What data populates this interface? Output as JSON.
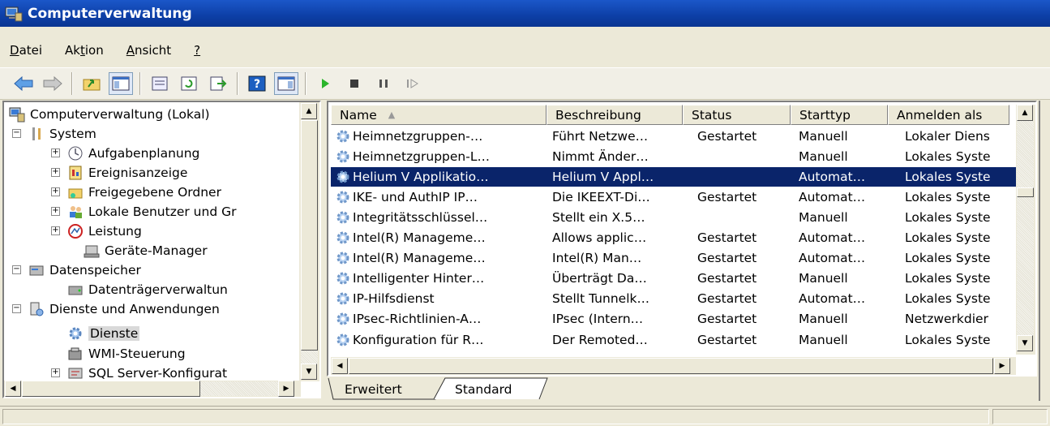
{
  "window": {
    "title": "Computerverwaltung"
  },
  "menu": {
    "datei": {
      "accel": "D",
      "rest": "atei"
    },
    "aktion": {
      "pre": "Ak",
      "accel": "t",
      "post": "ion"
    },
    "ansicht": {
      "accel": "A",
      "rest": "nsicht"
    },
    "help": {
      "accel": "?"
    }
  },
  "toolbar": {
    "icons": [
      "back-arrow-icon",
      "forward-arrow-icon",
      "folder-up-icon",
      "show-tree-icon",
      "properties-icon",
      "refresh-icon",
      "export-list-icon",
      "help-icon",
      "console-view-icon",
      "play-icon",
      "stop-icon",
      "pause-icon",
      "resume-icon"
    ]
  },
  "tree": {
    "root": "Computerverwaltung (Lokal)",
    "system": "System",
    "aufgaben": "Aufgabenplanung",
    "ereignis": "Ereignisanzeige",
    "freigaben": "Freigegebene Ordner",
    "lokale": "Lokale Benutzer und Gr",
    "leistung": "Leistung",
    "geraete": "Geräte-Manager",
    "datenspeicher": "Datenspeicher",
    "datentraeger": "Datenträgerverwaltun",
    "dienste_anw": "Dienste und Anwendungen",
    "dienste": "Dienste",
    "wmi": "WMI-Steuerung",
    "sql": "SQL Server-Konfigurat"
  },
  "list": {
    "columns": [
      "Name",
      "Beschreibung",
      "Status",
      "Starttyp",
      "Anmelden als"
    ],
    "sort_indicator": "▲",
    "rows": [
      {
        "name": "Heimnetzgruppen-…",
        "desc": "Führt Netzwe…",
        "status": "Gestartet",
        "start": "Manuell",
        "logon": "Lokaler Diens"
      },
      {
        "name": "Heimnetzgruppen-L…",
        "desc": "Nimmt Änder…",
        "status": "",
        "start": "Manuell",
        "logon": "Lokales Syste"
      },
      {
        "name": "Helium V Applikatio…",
        "desc": "Helium V Appl…",
        "status": "",
        "start": "Automat…",
        "logon": "Lokales Syste"
      },
      {
        "name": "IKE- und AuthIP IP…",
        "desc": "Die IKEEXT-Di…",
        "status": "Gestartet",
        "start": "Automat…",
        "logon": "Lokales Syste"
      },
      {
        "name": "Integritätsschlüssel…",
        "desc": "Stellt ein X.5…",
        "status": "",
        "start": "Manuell",
        "logon": "Lokales Syste"
      },
      {
        "name": "Intel(R) Manageme…",
        "desc": "Allows applic…",
        "status": "Gestartet",
        "start": "Automat…",
        "logon": "Lokales Syste"
      },
      {
        "name": "Intel(R) Manageme…",
        "desc": "Intel(R) Man…",
        "status": "Gestartet",
        "start": "Automat…",
        "logon": "Lokales Syste"
      },
      {
        "name": "Intelligenter Hinter…",
        "desc": "Überträgt Da…",
        "status": "Gestartet",
        "start": "Manuell",
        "logon": "Lokales Syste"
      },
      {
        "name": "IP-Hilfsdienst",
        "desc": "Stellt Tunnelk…",
        "status": "Gestartet",
        "start": "Automat…",
        "logon": "Lokales Syste"
      },
      {
        "name": "IPsec-Richtlinien-A…",
        "desc": "IPsec (Intern…",
        "status": "Gestartet",
        "start": "Manuell",
        "logon": "Netzwerkdier"
      },
      {
        "name": "Konfiguration für R…",
        "desc": "Der Remoted…",
        "status": "Gestartet",
        "start": "Manuell",
        "logon": "Lokales Syste"
      }
    ],
    "selected_index": 2
  },
  "tabs": {
    "erweitert": "Erweitert",
    "standard": "Standard"
  },
  "colors": {
    "title_bar": "#0d3fa6",
    "selection": "#0a246a",
    "face": "#ece9d8"
  }
}
